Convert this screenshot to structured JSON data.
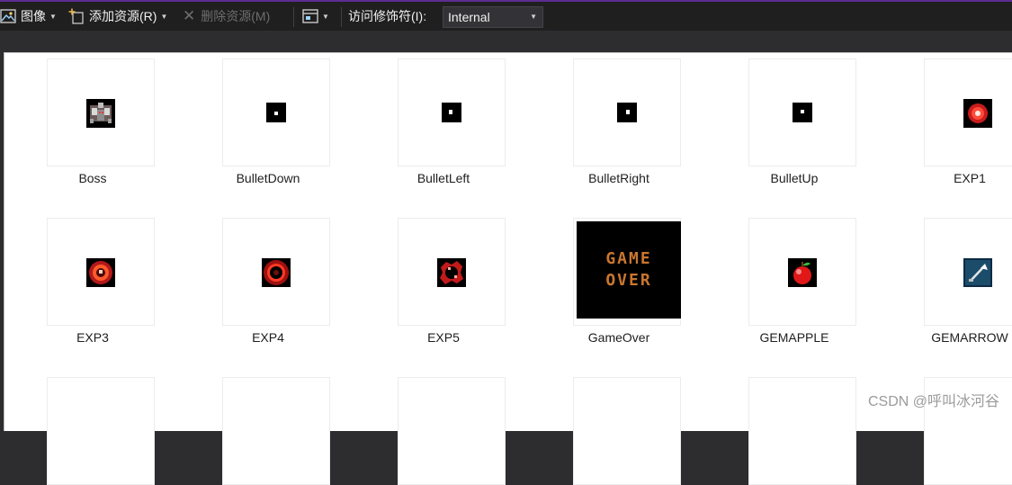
{
  "toolbar": {
    "image_label": "图像",
    "add_resource_label": "添加资源(R)",
    "remove_resource_label": "删除资源(M)",
    "access_modifier_label": "访问修饰符(I):",
    "access_modifier_value": "Internal"
  },
  "resources": {
    "row1": [
      "Boss",
      "BulletDown",
      "BulletLeft",
      "BulletRight",
      "BulletUp",
      "EXP1"
    ],
    "row2": [
      "EXP3",
      "EXP4",
      "EXP5",
      "GameOver",
      "GEMAPPLE",
      "GEMARROW"
    ]
  },
  "game_over_text": [
    "GAME",
    "OVER"
  ],
  "watermark": "CSDN @呼叫冰河谷",
  "colors": {
    "toolbar_bg": "#1f1f1f",
    "accent": "#5c2d91",
    "canvas_bg": "#ffffff"
  }
}
